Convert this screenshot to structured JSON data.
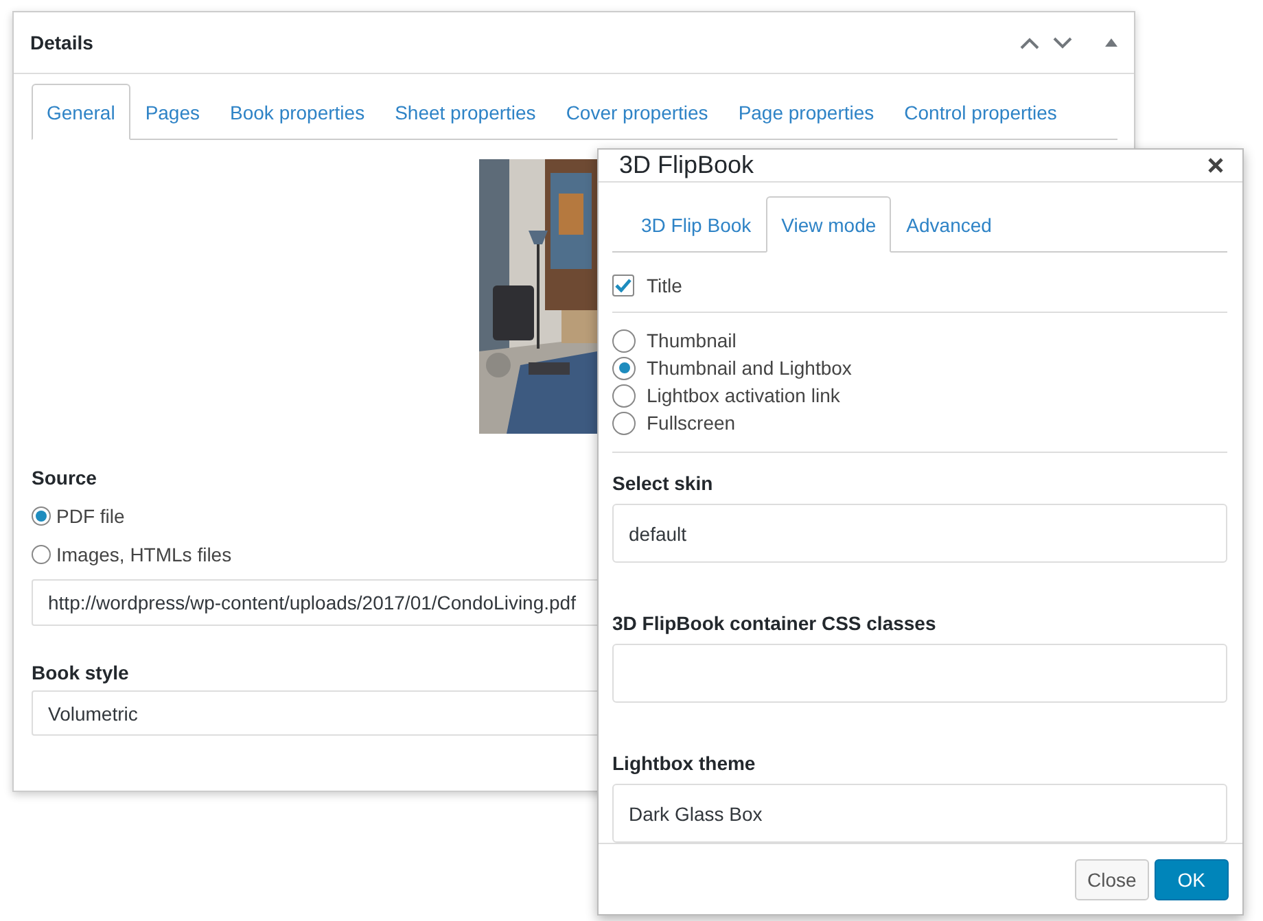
{
  "details": {
    "title": "Details",
    "tabs": [
      {
        "label": "General",
        "selected": true
      },
      {
        "label": "Pages",
        "selected": false
      },
      {
        "label": "Book properties",
        "selected": false
      },
      {
        "label": "Sheet properties",
        "selected": false
      },
      {
        "label": "Cover properties",
        "selected": false
      },
      {
        "label": "Page properties",
        "selected": false
      },
      {
        "label": "Control properties",
        "selected": false
      }
    ],
    "source": {
      "label": "Source",
      "options": [
        {
          "label": "PDF file",
          "selected": true
        },
        {
          "label": "Images, HTMLs files",
          "selected": false
        }
      ]
    },
    "url": {
      "value": "http://wordpress/wp-content/uploads/2017/01/CondoLiving.pdf"
    },
    "book_style": {
      "label": "Book style",
      "value": "Volumetric"
    }
  },
  "dialog": {
    "title": "3D FlipBook",
    "tabs": [
      {
        "label": "3D Flip Book",
        "selected": false
      },
      {
        "label": "View mode",
        "selected": true
      },
      {
        "label": "Advanced",
        "selected": false
      }
    ],
    "title_option": {
      "label": "Title",
      "checked": true
    },
    "modes": [
      {
        "label": "Thumbnail",
        "selected": false
      },
      {
        "label": "Thumbnail and Lightbox",
        "selected": true
      },
      {
        "label": "Lightbox activation link",
        "selected": false
      },
      {
        "label": "Fullscreen",
        "selected": false
      }
    ],
    "fields": [
      {
        "label": "Select skin",
        "value": "default"
      },
      {
        "label": "3D FlipBook container CSS classes"
      },
      {
        "label": "Lightbox theme",
        "value": "Dark Glass Box"
      }
    ],
    "buttons": [
      {
        "label": "Close",
        "kind": "secondary"
      },
      {
        "label": "OK",
        "kind": "primary"
      }
    ]
  }
}
